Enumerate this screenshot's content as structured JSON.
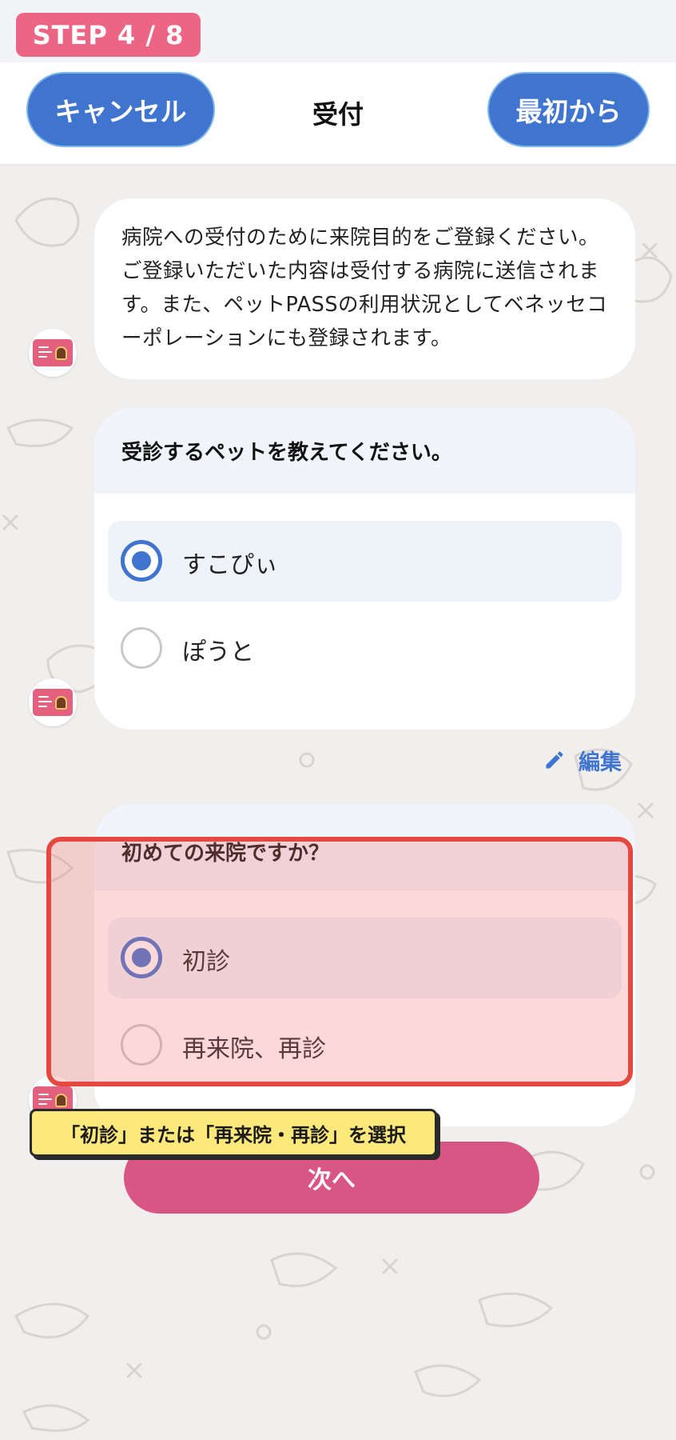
{
  "step": {
    "label": "STEP 4 / 8"
  },
  "header": {
    "cancel_label": "キャンセル",
    "title": "受付",
    "restart_label": "最初から"
  },
  "chat": {
    "intro_message": "病院への受付のために来院目的をご登録ください。ご登録いただいた内容は受付する病院に送信されます。また、ペットPASSの利用状況としてベネッセコーポレーションにも登録されます。",
    "pet_question": {
      "title": "受診するペットを教えてください。",
      "options": [
        {
          "label": "すこぴぃ",
          "selected": true
        },
        {
          "label": "ぽうと",
          "selected": false
        }
      ]
    },
    "edit_label": "編集",
    "visit_question": {
      "title": "初めての来院ですか？",
      "options": [
        {
          "label": "初診",
          "selected": true
        },
        {
          "label": "再来院、再診",
          "selected": false
        }
      ]
    }
  },
  "next_label": "次へ",
  "annotation": {
    "tooltip": "「初診」または「再来院・再診」を選択"
  },
  "icons": {
    "avatar": "pet-pass-card-icon",
    "edit": "pencil-icon",
    "background": "animal-doodle-pattern"
  },
  "colors": {
    "accent_blue": "#3f74cf",
    "pink_primary": "#d95584",
    "step_badge": "#ec6585",
    "highlight_border": "#e5483e",
    "tooltip_bg": "#fde87c",
    "background": "#f1efed"
  }
}
